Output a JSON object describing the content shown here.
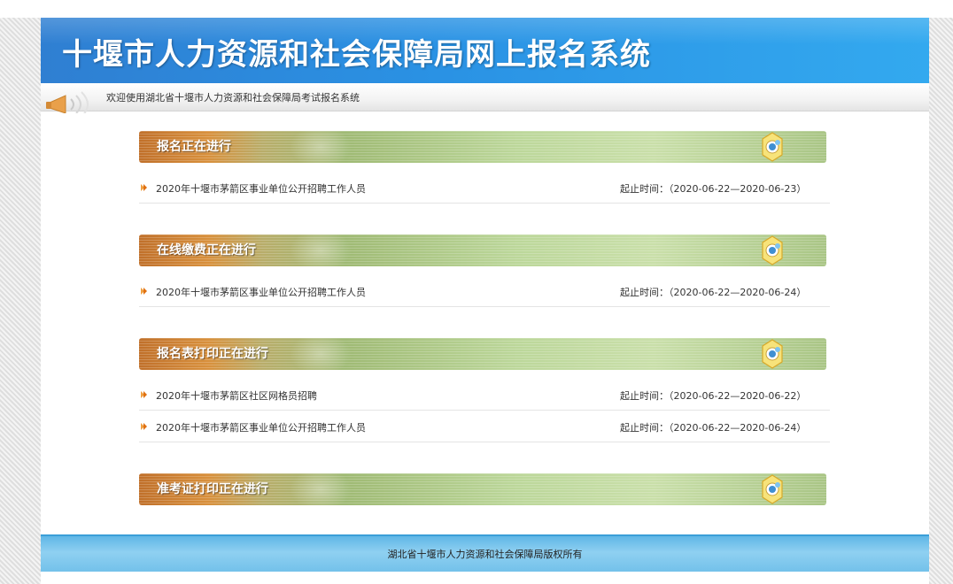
{
  "header": {
    "title": "十堰市人力资源和社会保障局网上报名系统",
    "welcome": "欢迎使用湖北省十堰市人力资源和社会保障局考试报名系统"
  },
  "sections": [
    {
      "title": "报名正在进行",
      "items": [
        {
          "title": "2020年十堰市茅箭区事业单位公开招聘工作人员",
          "date": "起止时间：（2020-06-22—2020-06-23）"
        }
      ]
    },
    {
      "title": "在线缴费正在进行",
      "items": [
        {
          "title": "2020年十堰市茅箭区事业单位公开招聘工作人员",
          "date": "起止时间：（2020-06-22—2020-06-24）"
        }
      ]
    },
    {
      "title": "报名表打印正在进行",
      "items": [
        {
          "title": "2020年十堰市茅箭区社区网格员招聘",
          "date": "起止时间：（2020-06-22—2020-06-22）"
        },
        {
          "title": "2020年十堰市茅箭区事业单位公开招聘工作人员",
          "date": "起止时间：（2020-06-22—2020-06-24）"
        }
      ]
    },
    {
      "title": "准考证打印正在进行",
      "items": []
    }
  ],
  "footer": {
    "copyright": "湖北省十堰市人力资源和社会保障局版权所有"
  },
  "colors": {
    "banner_blue": "#2a92e4",
    "footer_blue": "#73c1ea",
    "section_green": "#bcd79a",
    "bullet_orange": "#f08a1c"
  },
  "icons": {
    "welcome": "horn-icon",
    "section": "gear-icon",
    "item_bullet": "bullet-arrow-icon"
  }
}
